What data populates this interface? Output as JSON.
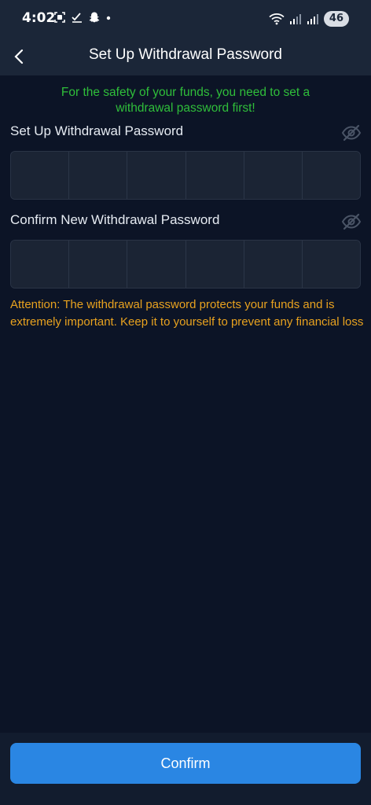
{
  "status_bar": {
    "time": "4:02",
    "battery": "46"
  },
  "header": {
    "title": "Set Up Withdrawal Password"
  },
  "notice": "For the safety of your funds, you need to set a withdrawal password first!",
  "fields": [
    {
      "label": "Set Up Withdrawal Password",
      "digits": 6
    },
    {
      "label": "Confirm New Withdrawal Password",
      "digits": 6
    }
  ],
  "attention": "Attention: The withdrawal password protects your funds and is extremely important. Keep it to yourself to prevent any financial loss",
  "confirm_label": "Confirm",
  "colors": {
    "background": "#0c1426",
    "bar": "#1b2638",
    "notice_green": "#2fbe3a",
    "attention_orange": "#e8a21f",
    "button_blue": "#2a86e3"
  },
  "icons": {
    "back": "chevron-left-icon",
    "visibility": "eye-off-icon"
  }
}
